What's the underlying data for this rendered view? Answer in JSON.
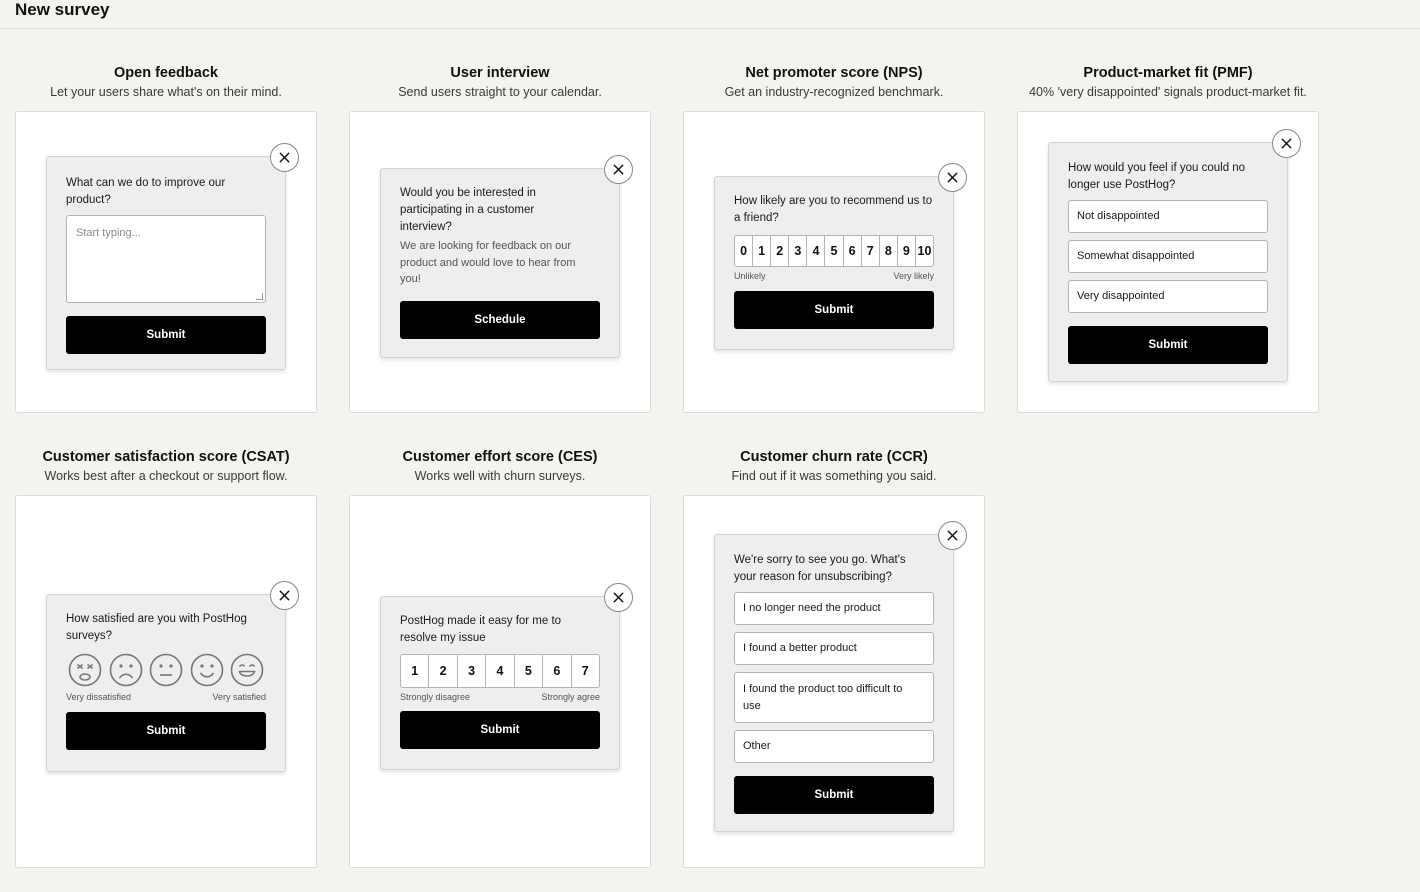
{
  "page": {
    "title": "New survey"
  },
  "templates": {
    "open_feedback": {
      "title": "Open feedback",
      "description": "Let your users share what's on their mind.",
      "question": "What can we do to improve our product?",
      "placeholder": "Start typing...",
      "button": "Submit"
    },
    "user_interview": {
      "title": "User interview",
      "description": "Send users straight to your calendar.",
      "question": "Would you be interested in participating in a customer interview?",
      "question_description": "We are looking for feedback on our product and would love to hear from you!",
      "button": "Schedule"
    },
    "nps": {
      "title": "Net promoter score (NPS)",
      "description": "Get an industry-recognized benchmark.",
      "question": "How likely are you to recommend us to a friend?",
      "scale": [
        "0",
        "1",
        "2",
        "3",
        "4",
        "5",
        "6",
        "7",
        "8",
        "9",
        "10"
      ],
      "low_label": "Unlikely",
      "high_label": "Very likely",
      "button": "Submit"
    },
    "pmf": {
      "title": "Product-market fit (PMF)",
      "description": "40% 'very disappointed' signals product-market fit.",
      "question": "How would you feel if you could no longer use PostHog?",
      "options": [
        "Not disappointed",
        "Somewhat disappointed",
        "Very disappointed"
      ],
      "button": "Submit"
    },
    "csat": {
      "title": "Customer satisfaction score (CSAT)",
      "description": "Works best after a checkout or support flow.",
      "question": "How satisfied are you with PostHog surveys?",
      "emojis": [
        "very-dissatisfied-face-icon",
        "dissatisfied-face-icon",
        "neutral-face-icon",
        "satisfied-face-icon",
        "very-satisfied-face-icon"
      ],
      "low_label": "Very dissatisfied",
      "high_label": "Very satisfied",
      "button": "Submit"
    },
    "ces": {
      "title": "Customer effort score (CES)",
      "description": "Works well with churn surveys.",
      "question": "PostHog made it easy for me to resolve my issue",
      "scale": [
        "1",
        "2",
        "3",
        "4",
        "5",
        "6",
        "7"
      ],
      "low_label": "Strongly disagree",
      "high_label": "Strongly agree",
      "button": "Submit"
    },
    "ccr": {
      "title": "Customer churn rate (CCR)",
      "description": "Find out if it was something you said.",
      "question": "We're sorry to see you go. What's your reason for unsubscribing?",
      "options": [
        "I no longer need the product",
        "I found a better product",
        "I found the product too difficult to use",
        "Other"
      ],
      "button": "Submit"
    }
  },
  "colors": {
    "background": "#f3f3ef",
    "card": "#ffffff",
    "survey": "#eeeeee",
    "button": "#000000"
  }
}
